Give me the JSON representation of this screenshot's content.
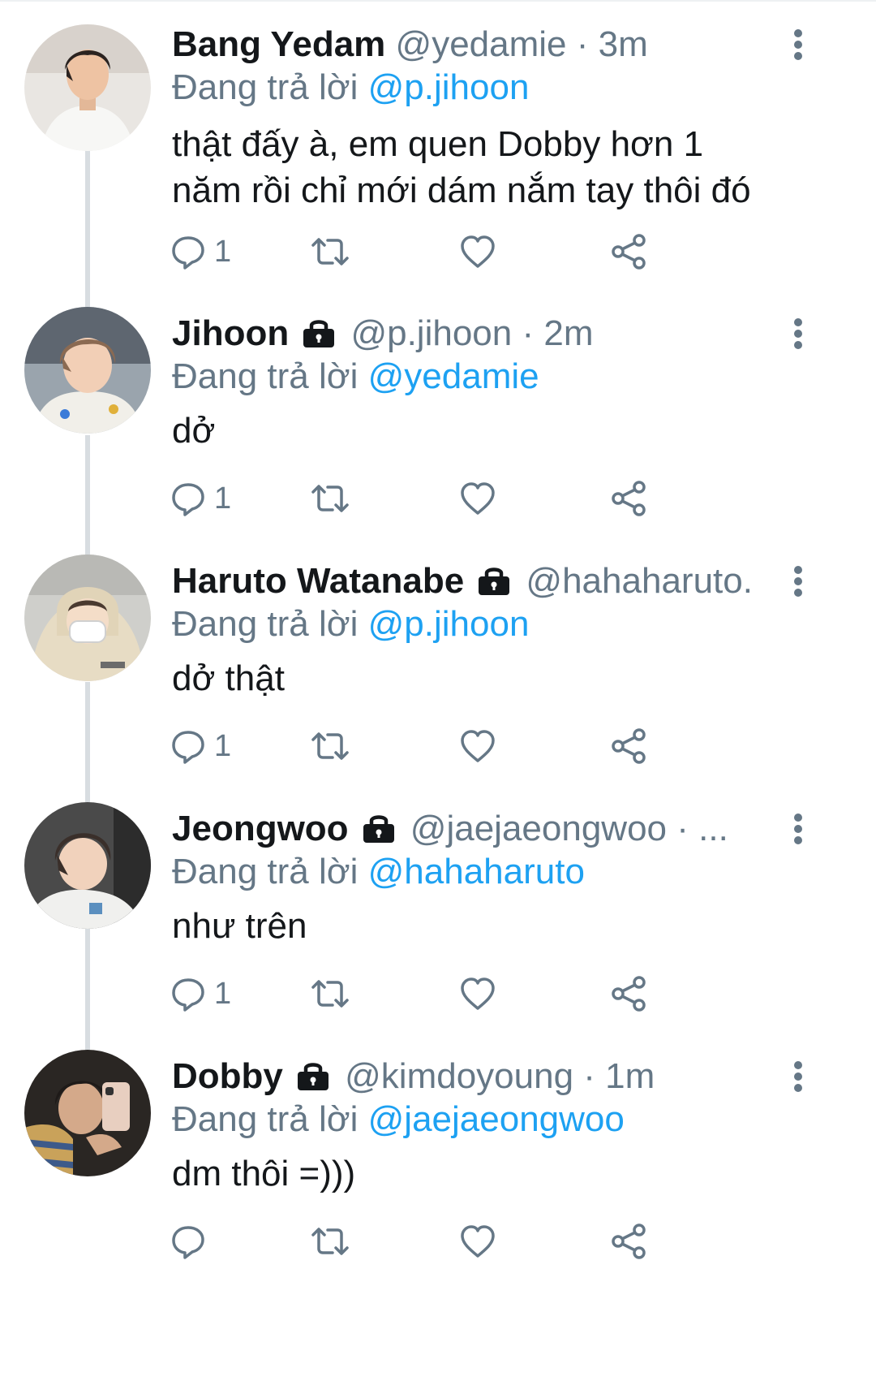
{
  "reply_prefix": "Đang trả lời",
  "colors": {
    "link": "#1da1f2",
    "secondary_text": "#657786",
    "primary_text": "#14171a",
    "thread_line": "#d8dde1"
  },
  "tweets": [
    {
      "name": "Bang Yedam",
      "locked": false,
      "handle": "@yedamie",
      "separator": "·",
      "time": "3m",
      "reply_to": "@p.jihoon",
      "text_lines": [
        "thật đấy à, em quen Dobby hơn 1",
        "năm rồi chỉ mới dám nắm tay thôi đó"
      ],
      "reply_count": "1"
    },
    {
      "name": "Jihoon",
      "locked": true,
      "handle": "@p.jihoon",
      "separator": "·",
      "time": "2m",
      "reply_to": "@yedamie",
      "text_lines": [
        "dở"
      ],
      "reply_count": "1"
    },
    {
      "name": "Haruto Watanabe",
      "locked": true,
      "handle": "@hahaharuto.",
      "separator": "",
      "time": "",
      "reply_to": "@p.jihoon",
      "text_lines": [
        "dở thật"
      ],
      "reply_count": "1"
    },
    {
      "name": "Jeongwoo",
      "locked": true,
      "handle": "@jaejaeongwoo",
      "separator": "·",
      "time": "...",
      "reply_to": "@hahaharuto",
      "text_lines": [
        "như trên"
      ],
      "reply_count": "1"
    },
    {
      "name": "Dobby",
      "locked": true,
      "handle": "@kimdoyoung",
      "separator": "·",
      "time": "1m",
      "reply_to": "@jaejaeongwoo",
      "text_lines": [
        "dm thôi =)))"
      ],
      "reply_count": ""
    }
  ]
}
